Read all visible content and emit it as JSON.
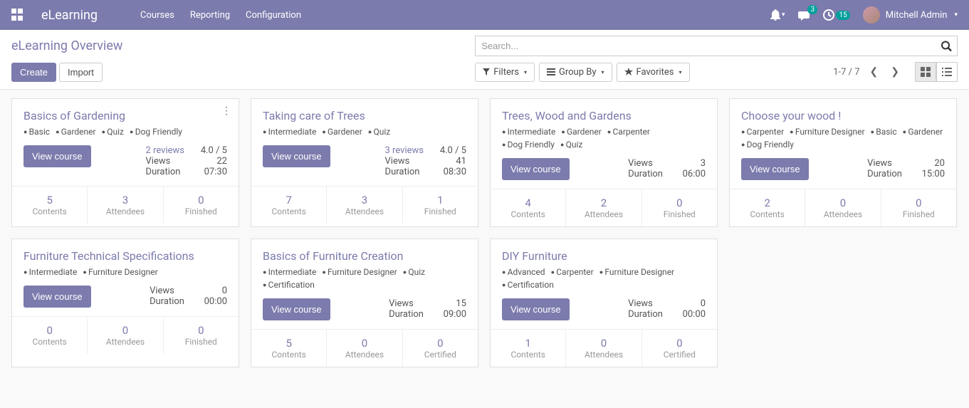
{
  "nav": {
    "app_name": "eLearning",
    "menu": [
      "Courses",
      "Reporting",
      "Configuration"
    ],
    "messages_badge": "3",
    "clock_badge": "15",
    "user_name": "Mitchell Admin"
  },
  "cp": {
    "breadcrumb": "eLearning Overview",
    "search_placeholder": "Search...",
    "create": "Create",
    "import": "Import",
    "filters": "Filters",
    "groupby": "Group By",
    "favorites": "Favorites",
    "pager": "1-7 / 7"
  },
  "labels": {
    "view_course": "View course",
    "views": "Views",
    "duration": "Duration",
    "contents": "Contents",
    "attendees": "Attendees",
    "finished": "Finished",
    "certified": "Certified"
  },
  "cards": [
    {
      "title": "Basics of Gardening",
      "tags": [
        "Basic",
        "Gardener",
        "Quiz",
        "Dog Friendly"
      ],
      "reviews": "2 reviews",
      "rating": "4.0 / 5",
      "views": "22",
      "duration": "07:30",
      "footer": [
        {
          "num": "5",
          "lbl": "Contents"
        },
        {
          "num": "3",
          "lbl": "Attendees"
        },
        {
          "num": "0",
          "lbl": "Finished"
        }
      ],
      "show_menu": true
    },
    {
      "title": "Taking care of Trees",
      "tags": [
        "Intermediate",
        "Gardener",
        "Quiz"
      ],
      "reviews": "3 reviews",
      "rating": "4.0 / 5",
      "views": "41",
      "duration": "08:30",
      "footer": [
        {
          "num": "7",
          "lbl": "Contents"
        },
        {
          "num": "3",
          "lbl": "Attendees"
        },
        {
          "num": "1",
          "lbl": "Finished"
        }
      ]
    },
    {
      "title": "Trees, Wood and Gardens",
      "tags": [
        "Intermediate",
        "Gardener",
        "Carpenter",
        "Dog Friendly",
        "Quiz"
      ],
      "views": "3",
      "duration": "06:00",
      "footer": [
        {
          "num": "4",
          "lbl": "Contents"
        },
        {
          "num": "2",
          "lbl": "Attendees"
        },
        {
          "num": "0",
          "lbl": "Finished"
        }
      ]
    },
    {
      "title": "Choose your wood !",
      "tags": [
        "Carpenter",
        "Furniture Designer",
        "Basic",
        "Gardener",
        "Dog Friendly"
      ],
      "views": "20",
      "duration": "15:00",
      "footer": [
        {
          "num": "2",
          "lbl": "Contents"
        },
        {
          "num": "0",
          "lbl": "Attendees"
        },
        {
          "num": "0",
          "lbl": "Finished"
        }
      ]
    },
    {
      "title": "Furniture Technical Specifications",
      "tags": [
        "Intermediate",
        "Furniture Designer"
      ],
      "views": "0",
      "duration": "00:00",
      "footer": [
        {
          "num": "0",
          "lbl": "Contents"
        },
        {
          "num": "0",
          "lbl": "Attendees"
        },
        {
          "num": "0",
          "lbl": "Finished"
        }
      ]
    },
    {
      "title": "Basics of Furniture Creation",
      "tags": [
        "Intermediate",
        "Furniture Designer",
        "Quiz",
        "Certification"
      ],
      "views": "15",
      "duration": "09:00",
      "footer": [
        {
          "num": "5",
          "lbl": "Contents"
        },
        {
          "num": "0",
          "lbl": "Attendees"
        },
        {
          "num": "0",
          "lbl": "Certified"
        }
      ]
    },
    {
      "title": "DIY Furniture",
      "tags": [
        "Advanced",
        "Carpenter",
        "Furniture Designer",
        "Certification"
      ],
      "views": "0",
      "duration": "00:00",
      "footer": [
        {
          "num": "1",
          "lbl": "Contents"
        },
        {
          "num": "0",
          "lbl": "Attendees"
        },
        {
          "num": "0",
          "lbl": "Certified"
        }
      ]
    }
  ]
}
